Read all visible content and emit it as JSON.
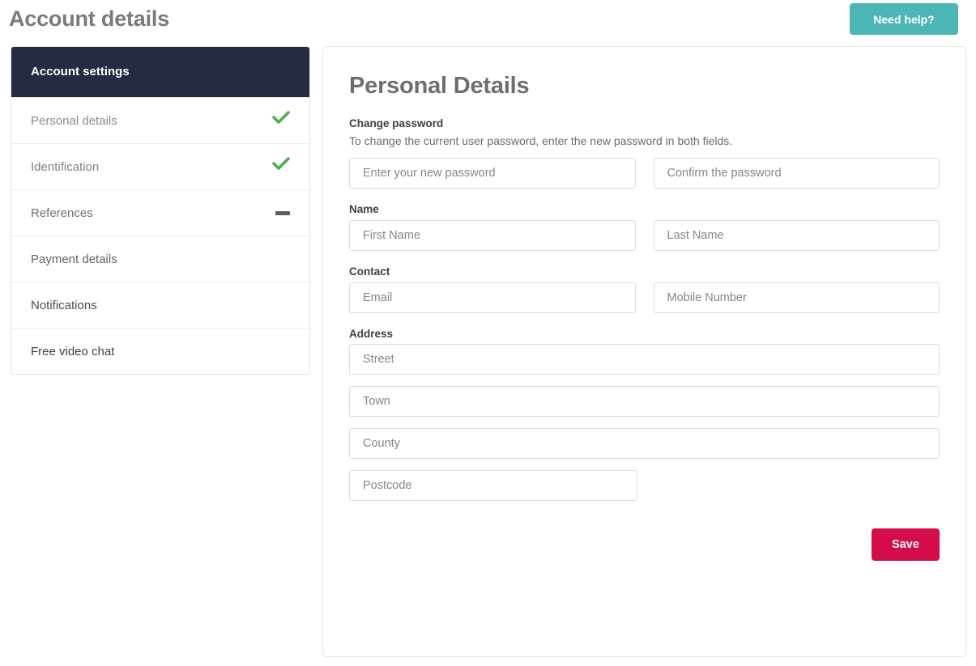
{
  "header": {
    "title": "Account details",
    "help_button": "Need help?",
    "help_button_color": "#4cb6b4"
  },
  "sidebar": {
    "heading": "Account settings",
    "heading_bg": "#242c42",
    "items": [
      {
        "label": "Personal details",
        "status": "check",
        "icon": "check-icon"
      },
      {
        "label": "Identification",
        "status": "check",
        "icon": "check-icon"
      },
      {
        "label": "References",
        "status": "dash",
        "icon": "minus-icon"
      },
      {
        "label": "Payment details",
        "status": "none",
        "icon": ""
      },
      {
        "label": "Notifications",
        "status": "none",
        "icon": ""
      },
      {
        "label": "Free video chat",
        "status": "none",
        "icon": ""
      }
    ],
    "check_color": "#4caf50",
    "dash_color": "#5d5d5d"
  },
  "main": {
    "title": "Personal Details",
    "sections": {
      "password": {
        "label": "Change password",
        "description": "To change the current user password, enter the new password in both fields.",
        "new_password_placeholder": "Enter your new password",
        "new_password_value": "",
        "confirm_password_placeholder": "Confirm the password",
        "confirm_password_value": ""
      },
      "name": {
        "label": "Name",
        "first_name_placeholder": "First Name",
        "first_name_value": "",
        "last_name_placeholder": "Last Name",
        "last_name_value": ""
      },
      "contact": {
        "label": "Contact",
        "email_placeholder": "Email",
        "email_value": "",
        "mobile_placeholder": "Mobile Number",
        "mobile_value": ""
      },
      "address": {
        "label": "Address",
        "street_placeholder": "Street",
        "street_value": "",
        "town_placeholder": "Town",
        "town_value": "",
        "county_placeholder": "County",
        "county_value": "",
        "postcode_placeholder": "Postcode",
        "postcode_value": ""
      }
    },
    "save_label": "Save",
    "save_color": "#d40d4a"
  }
}
